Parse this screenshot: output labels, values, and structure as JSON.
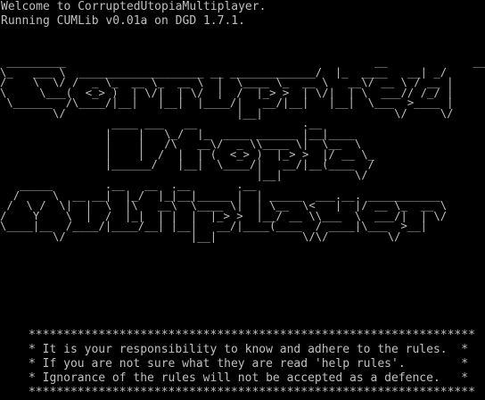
{
  "terminal": {
    "greeting": "Welcome to CorruptedUtopiaMultiplayer.",
    "version_line": "Running CUMLib v0.01a on DGD 1.7.1.",
    "banner_ascii": " _________                                               __             ___\n\\_   ___ \\  ___________________ __ _____________/  |_  ____   __| _/\n/    \\  \\/ /  _ \\_  __ \\_  __ \\  |  \\____ \\_  __ \\   __\\/ __ \\ / __ |\n\\     \\___(  <_> )  | \\/|  | \\/  |  /  |_> >  | \\/|  | \\  ___// /_/ |\n \\______  /\\____/|__|   |__|  |____/|   __/|__|   |__|  \\___  >____ |\n        \\/                          |__|                    \\/     \\/\n                 ____ ___   __                .__\n                |    |   \\_/  |_  ____ ______ |__|____\n                |    |   /\\   __\\/  _ \\\\____ \\|  \\__  \\\n                |    |  /  |  | (  <_> )  |_> >  |/ __ \\_\n                |______/   |__|  \\____/|   __/|__(____  /\n                                       |__|           \\/\n   _____        .__   __  .__       .__\n  /     \\  __ __|  |_/  |_|__|_____ |  | _____  ___.__. ___________\n /  \\ /  \\|  |  \\  |\\   __\\  \\____ \\|  | \\__  \\<   |  |/ __ \\_  __ \\\n/    Y    \\  |  /  |_|  | |  |  |_> >  |__/ __ \\\\___  \\  ___/|  | \\/\n\\____|__  /____/|____/__| |__|   __/|____(____  / ____|\\___  >__|\n        \\/                   |__|             \\/\\/         \\/",
    "rules_box": [
      "****************************************************************",
      "* It is your responsibility to know and adhere to the rules.  *",
      "* If you are not sure what they are read 'help rules'.        *",
      "* Ignorance of the rules will not be accepted as a defence.   *",
      "****************************************************************"
    ]
  }
}
